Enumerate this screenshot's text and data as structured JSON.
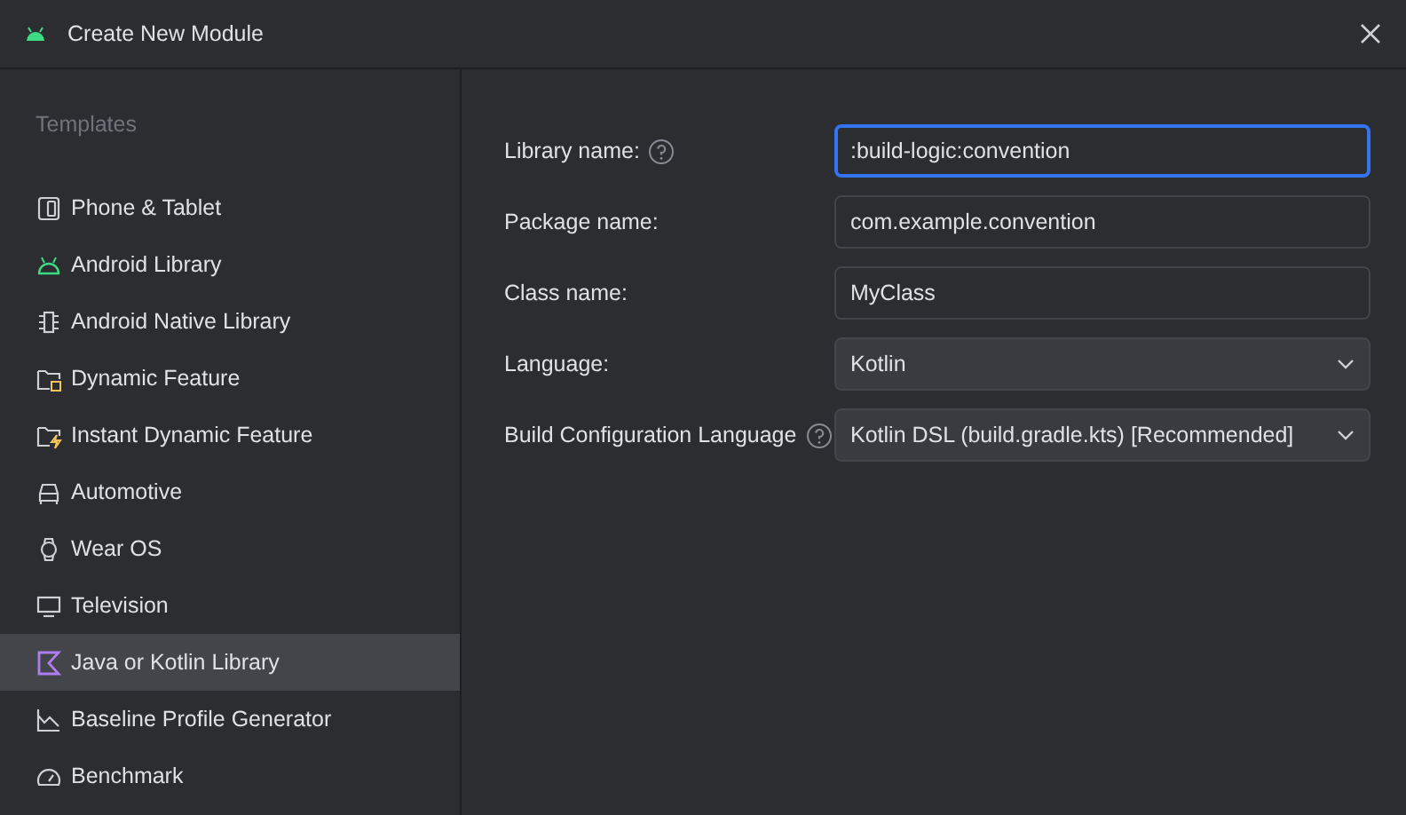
{
  "window": {
    "title": "Create New Module"
  },
  "sidebar": {
    "heading": "Templates",
    "items": [
      {
        "label": "Phone & Tablet",
        "kind": "phone",
        "selected": false
      },
      {
        "label": "Android Library",
        "kind": "android",
        "selected": false
      },
      {
        "label": "Android Native Library",
        "kind": "chip",
        "selected": false
      },
      {
        "label": "Dynamic Feature",
        "kind": "folder-dynamic",
        "selected": false
      },
      {
        "label": "Instant Dynamic Feature",
        "kind": "folder-instant",
        "selected": false
      },
      {
        "label": "Automotive",
        "kind": "car",
        "selected": false
      },
      {
        "label": "Wear OS",
        "kind": "watch",
        "selected": false
      },
      {
        "label": "Television",
        "kind": "tv",
        "selected": false
      },
      {
        "label": "Java or Kotlin Library",
        "kind": "kotlin",
        "selected": true
      },
      {
        "label": "Baseline Profile Generator",
        "kind": "chart",
        "selected": false
      },
      {
        "label": "Benchmark",
        "kind": "gauge",
        "selected": false
      }
    ]
  },
  "form": {
    "fields": [
      {
        "label": "Library name:",
        "help": true,
        "kind": "text",
        "value": ":build-logic:convention",
        "focused": true
      },
      {
        "label": "Package name:",
        "help": false,
        "kind": "text",
        "value": "com.example.convention",
        "focused": false
      },
      {
        "label": "Class name:",
        "help": false,
        "kind": "text",
        "value": "MyClass",
        "focused": false
      },
      {
        "label": "Language:",
        "help": false,
        "kind": "dropdown",
        "value": "Kotlin",
        "focused": false
      },
      {
        "label": "Build Configuration Language",
        "help": true,
        "kind": "dropdown",
        "value": "Kotlin DSL (build.gradle.kts) [Recommended]",
        "focused": false
      }
    ]
  }
}
